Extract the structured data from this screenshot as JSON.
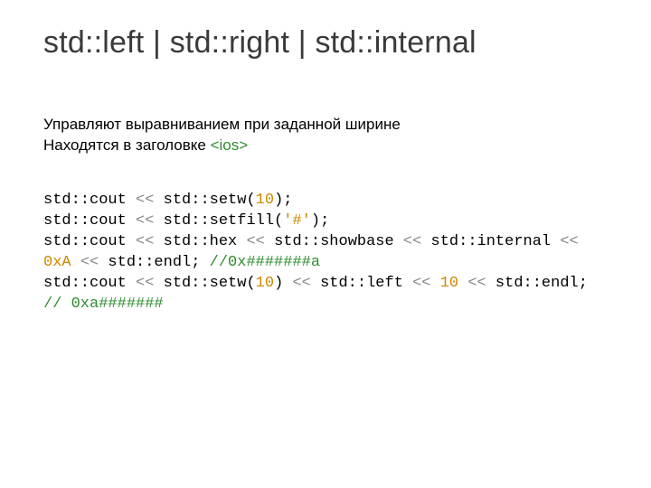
{
  "title": "std::left | std::right | std::internal",
  "desc": {
    "line1": "Управляют выравниванием при заданной ширине",
    "line2_prefix": "Находятся в заголовке ",
    "line2_header": "<ios>"
  },
  "code": {
    "l1_a": "std::cout ",
    "l1_op": "<<",
    "l1_b": " std::setw(",
    "l1_n": "10",
    "l1_c": ");",
    "l2_a": "std::cout ",
    "l2_op": "<<",
    "l2_b": " std::setfill(",
    "l2_s": "'#'",
    "l2_c": ");",
    "l3_a": "std::cout ",
    "l3_op1": "<<",
    "l3_b": " std::hex ",
    "l3_op2": "<<",
    "l3_c": " std::showbase ",
    "l3_op3": "<<",
    "l3_d": " std::internal ",
    "l3_op4": "<<",
    "l3_e": " ",
    "l3_n": "0xA",
    "l3_f": " ",
    "l3_op5": "<<",
    "l3_g": " std::endl; ",
    "l3_cmt": "//0x#######a",
    "l4_a": "std::cout ",
    "l4_op1": "<<",
    "l4_b": " std::setw(",
    "l4_n1": "10",
    "l4_c": ") ",
    "l4_op2": "<<",
    "l4_d": " std::left ",
    "l4_op3": "<<",
    "l4_e": " ",
    "l4_n2": "10",
    "l4_f": " ",
    "l4_op4": "<<",
    "l4_g": " std::endl; ",
    "l4_cmt": "// 0xa#######"
  }
}
